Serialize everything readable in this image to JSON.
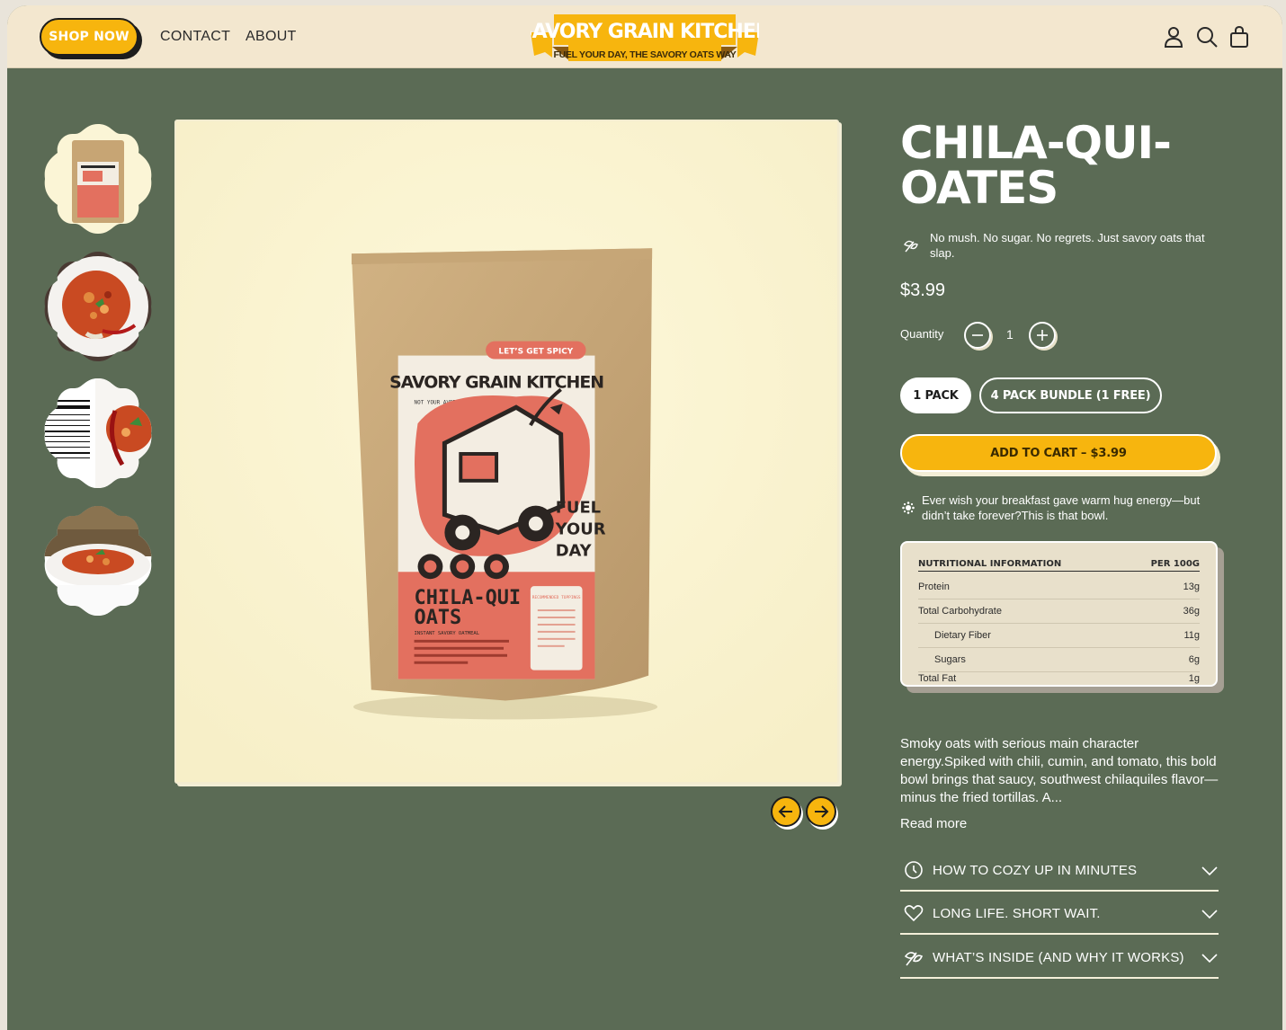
{
  "header": {
    "shop_now": "SHOP NOW",
    "nav": [
      "CONTACT",
      "ABOUT"
    ],
    "logo_title": "SAVORY GRAIN KITCHEN",
    "logo_tagline": "FUEL YOUR DAY, THE SAVORY OATS WAY",
    "icons": [
      "user-icon",
      "search-icon",
      "bag-icon"
    ]
  },
  "product": {
    "title_line1": "CHILA-QUI-",
    "title_line2": "OATES",
    "tagline": "No mush. No sugar. No regrets. Just savory oats that slap.",
    "price": "$3.99",
    "quantity_label": "Quantity",
    "quantity": "1",
    "packs": [
      "1 PACK",
      "4 PACK BUNDLE (1 FREE)"
    ],
    "selected_pack": "1 PACK",
    "add_to_cart": "ADD TO CART – $3.99",
    "hug_text": "Ever wish your breakfast gave warm hug energy—but didn’t take forever?This is that bowl.",
    "description": "Smoky oats with serious main character energy.Spiked with chili, cumin, and tomato, this bold bowl brings that saucy, southwest chilaquiles flavor—minus the fried tortillas. A...",
    "read_more": "Read more"
  },
  "package": {
    "badge": "LET’S GET SPICY",
    "brand": "SAVORY GRAIN KITCHEN",
    "not_your": "NOT YOUR AVERAGE OATS",
    "fuel": [
      "FUEL",
      "YOUR",
      "DAY"
    ],
    "name_line1": "CHILA-QUI",
    "name_line2": "OATS",
    "subtitle": "INSTANT SAVORY OATMEAL",
    "toppings_title": "RECOMMENDED TOPPINGS"
  },
  "nutrition": {
    "header": "NUTRITIONAL INFORMATION",
    "per": "PER 100G",
    "rows": [
      {
        "name": "Protein",
        "value": "13g"
      },
      {
        "name": "Total Carbohydrate",
        "value": "36g"
      },
      {
        "name": "Dietary Fiber",
        "value": "11g"
      },
      {
        "name": "Sugars",
        "value": "6g"
      },
      {
        "name": "Total Fat",
        "value": "1g"
      }
    ]
  },
  "accordion": [
    {
      "label": "HOW TO COZY UP IN MINUTES",
      "icon": "clock-icon"
    },
    {
      "label": "LONG LIFE. SHORT WAIT.",
      "icon": "heart-icon"
    },
    {
      "label": "WHAT’S INSIDE (AND WHY IT WORKS)",
      "icon": "leaf-icon"
    }
  ],
  "colors": {
    "page_bg": "#5b6b55",
    "header_bg": "#f3e7cf",
    "accent": "#f7b50e",
    "package_red": "#e3705f",
    "kraft": "#c9a878"
  }
}
